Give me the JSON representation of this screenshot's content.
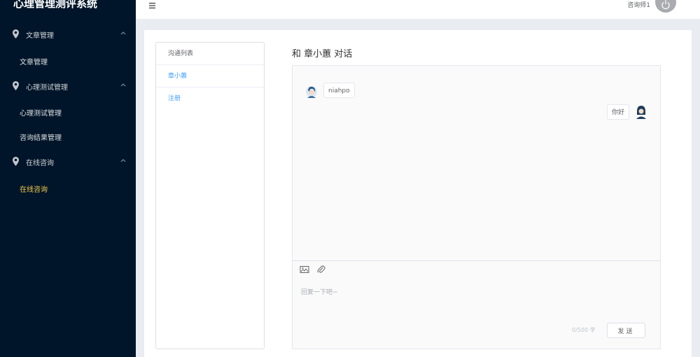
{
  "app": {
    "title": "心理管理测评系统"
  },
  "sidebar": {
    "groups": [
      {
        "label": "文章管理",
        "icon": "location-pin-icon",
        "items": [
          "文章管理"
        ]
      },
      {
        "label": "心理测试管理",
        "icon": "location-pin-icon",
        "items": [
          "心理测试管理",
          "咨询结果管理"
        ]
      },
      {
        "label": "在线咨询",
        "icon": "location-pin-icon",
        "items": [
          "在线咨询"
        ]
      }
    ],
    "active_item": "在线咨询"
  },
  "header": {
    "menu_icon": "hamburger-icon",
    "username": "咨询师1",
    "avatar_icon": "power-icon"
  },
  "contacts": {
    "header": "沟通列表",
    "items": [
      "章小蕙",
      "注册"
    ]
  },
  "chat": {
    "title": "和 章小蕙 对话",
    "messages": [
      {
        "side": "left",
        "text": "niahpo"
      },
      {
        "side": "right",
        "text": "你好"
      }
    ],
    "toolbar": [
      "image-icon",
      "paperclip-icon"
    ],
    "input_placeholder": "回复一下吧~",
    "counter": "0/500 字",
    "send_label": "发送"
  },
  "colors": {
    "sidebar_bg": "#001529",
    "active": "#f2c94c",
    "link": "#409eff"
  }
}
